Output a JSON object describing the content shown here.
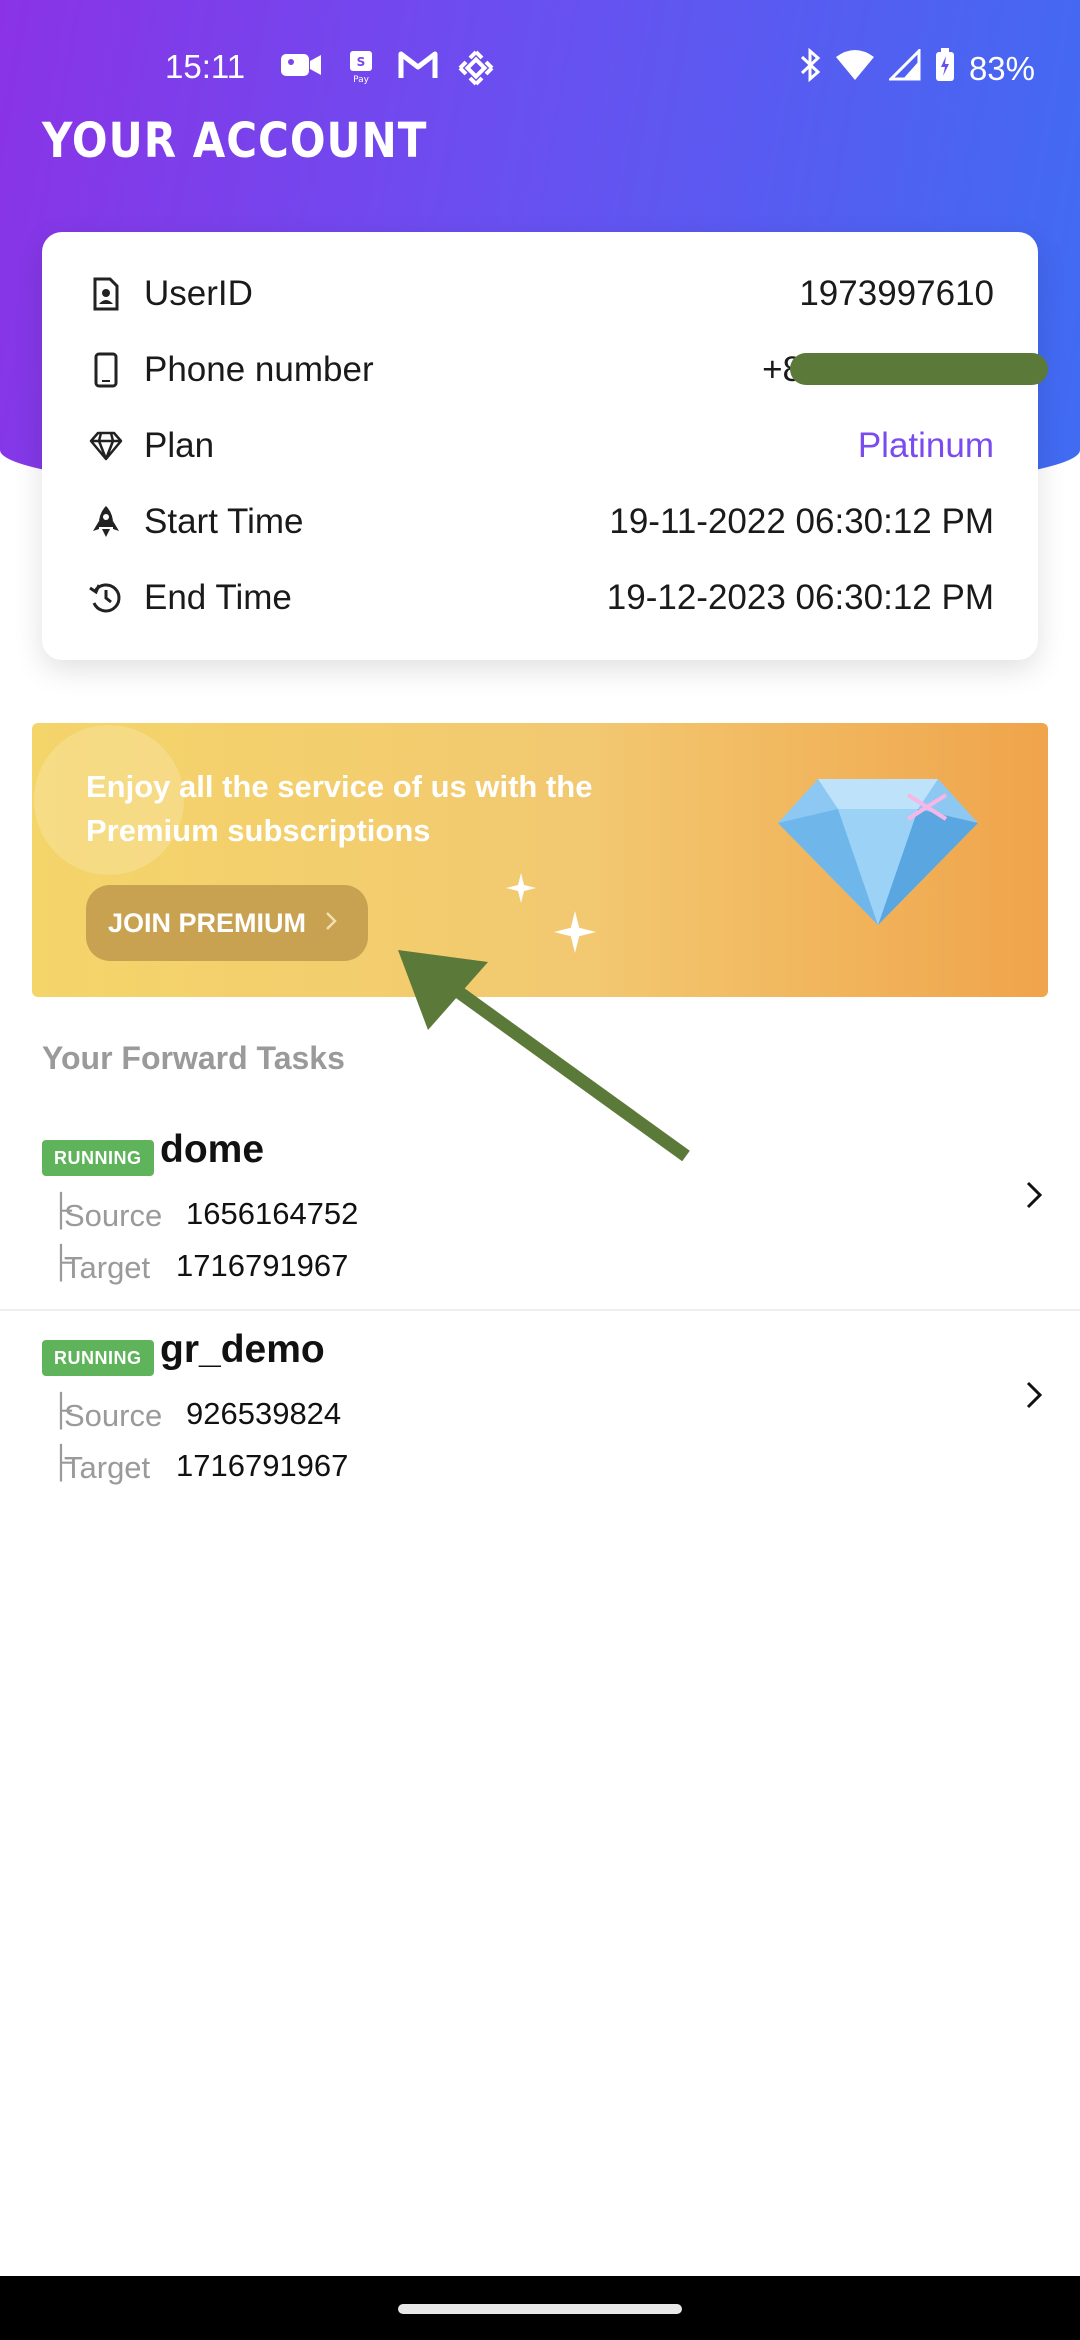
{
  "status_bar": {
    "time": "15:11",
    "battery": "83%",
    "left_icons": [
      "video-camera-icon",
      "samsung-pay-icon",
      "gmail-icon",
      "binance-icon"
    ],
    "right_icons": [
      "bluetooth-icon",
      "wifi-icon",
      "signal-icon",
      "battery-icon"
    ]
  },
  "header": {
    "title": "YOUR ACCOUNT"
  },
  "account": {
    "rows": [
      {
        "icon": "user-id-icon",
        "label": "UserID",
        "value": "1973997610"
      },
      {
        "icon": "phone-icon",
        "label": "Phone number",
        "value": "+8"
      },
      {
        "icon": "diamond-icon",
        "label": "Plan",
        "value": "Platinum"
      },
      {
        "icon": "rocket-icon",
        "label": "Start Time",
        "value": "19-11-2022 06:30:12 PM"
      },
      {
        "icon": "history-icon",
        "label": "End Time",
        "value": "19-12-2023 06:30:12 PM"
      }
    ]
  },
  "banner": {
    "text": "Enjoy all the service of us with the Premium subscriptions",
    "button_label": "JOIN PREMIUM",
    "gem_icon": "diamond-gem-icon"
  },
  "tasks": {
    "section_title": "Your Forward Tasks",
    "items": [
      {
        "status": "RUNNING",
        "name": "dome",
        "source_label": "Source",
        "source": "1656164752",
        "target_label": "Target",
        "target": "1716791967"
      },
      {
        "status": "RUNNING",
        "name": "gr_demo",
        "source_label": "Source",
        "source": "926539824",
        "target_label": "Target",
        "target": "1716791967"
      }
    ]
  },
  "colors": {
    "header_gradient_start": "#8a33e6",
    "header_gradient_end": "#3f6cf2",
    "plan_accent": "#7a4cf0",
    "running_badge": "#5fb35a",
    "annotation_arrow": "#5b7a3a"
  }
}
